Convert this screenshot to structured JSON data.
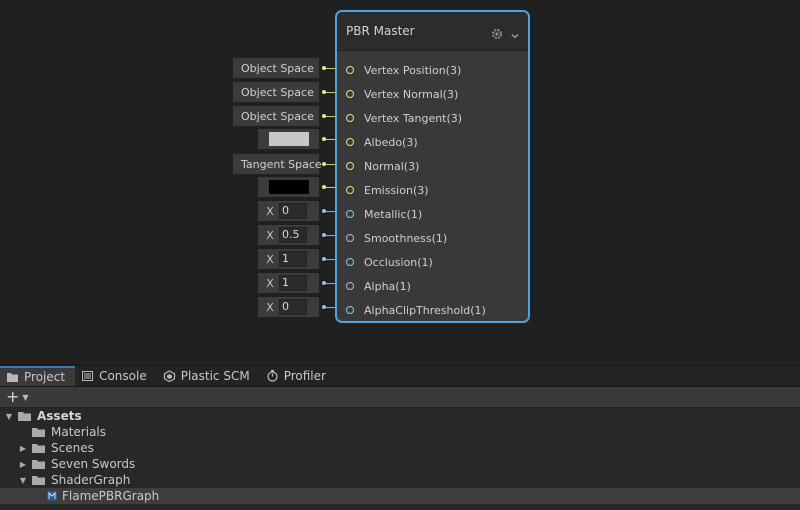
{
  "master_node": {
    "title": "PBR Master",
    "icons": [
      "gear-icon",
      "chevron-down-icon"
    ],
    "accent_color": "#4fa3e0",
    "ports": [
      {
        "label": "Vertex Position(3)",
        "type": "vector3"
      },
      {
        "label": "Vertex Normal(3)",
        "type": "vector3"
      },
      {
        "label": "Vertex Tangent(3)",
        "type": "vector3"
      },
      {
        "label": "Albedo(3)",
        "type": "vector3"
      },
      {
        "label": "Normal(3)",
        "type": "vector3"
      },
      {
        "label": "Emission(3)",
        "type": "vector3"
      },
      {
        "label": "Metallic(1)",
        "type": "vector1"
      },
      {
        "label": "Smoothness(1)",
        "type": "vector1"
      },
      {
        "label": "Occlusion(1)",
        "type": "vector1"
      },
      {
        "label": "Alpha(1)",
        "type": "vector1"
      },
      {
        "label": "AlphaClipThreshold(1)",
        "type": "vector1"
      }
    ]
  },
  "inputs": {
    "vertex_position": "Object Space",
    "vertex_normal": "Object Space",
    "vertex_tangent": "Object Space",
    "albedo_color": "#c8c8c8",
    "normal": "Tangent Space",
    "emission_color": "#000000",
    "metallic": {
      "axis": "X",
      "value": "0"
    },
    "smoothness": {
      "axis": "X",
      "value": "0.5"
    },
    "occlusion": {
      "axis": "X",
      "value": "1"
    },
    "alpha": {
      "axis": "X",
      "value": "1"
    },
    "alpha_clip": {
      "axis": "X",
      "value": "0"
    }
  },
  "tabs": [
    {
      "label": "Project",
      "icon": "folder-icon",
      "active": true
    },
    {
      "label": "Console",
      "icon": "console-icon",
      "active": false
    },
    {
      "label": "Plastic SCM",
      "icon": "plastic-icon",
      "active": false
    },
    {
      "label": "Profiler",
      "icon": "profiler-icon",
      "active": false
    }
  ],
  "toolbar": {
    "add": "+",
    "add_dropdown": "▼"
  },
  "tree": [
    {
      "label": "Assets",
      "expanded": true
    },
    {
      "label": "Materials"
    },
    {
      "label": "Scenes",
      "expandable": true
    },
    {
      "label": "Seven Swords",
      "expandable": true
    },
    {
      "label": "ShaderGraph",
      "expanded": true
    },
    {
      "label": "FlamePBRGraph",
      "selected": true
    }
  ]
}
